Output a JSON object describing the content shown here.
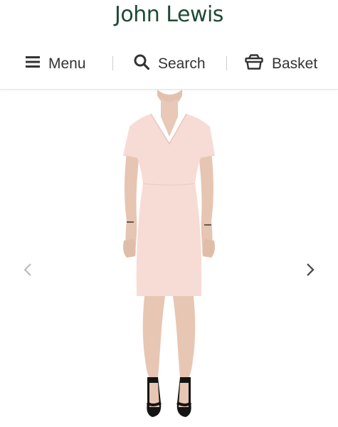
{
  "header": {
    "logo_text": "John Lewis",
    "nav": {
      "menu_label": "Menu",
      "search_label": "Search",
      "basket_label": "Basket"
    }
  },
  "gallery": {
    "product_image": "model-wearing-pale-pink-v-neck-shift-dress",
    "prev_arrow_icon": "chevron-left-icon",
    "next_arrow_icon": "chevron-right-icon"
  },
  "colors": {
    "brand_green": "#1f4a35",
    "nav_text": "#333333",
    "dress_pink": "#f7dcd6"
  }
}
